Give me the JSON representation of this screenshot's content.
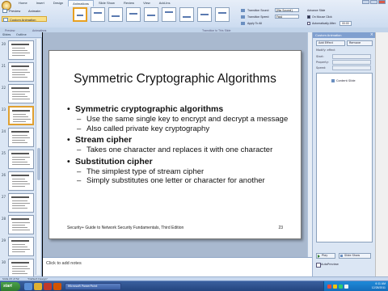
{
  "ribbon": {
    "tabs": [
      "Home",
      "Insert",
      "Design",
      "Animations",
      "Slide Show",
      "Review",
      "View",
      "Add-Ins"
    ],
    "active_tab": "Animations",
    "preview_label": "Preview",
    "animate_label": "Animate:",
    "animate_value": "No Animation",
    "custom_animation_label": "Custom Animation",
    "groups": [
      "Preview",
      "Animations",
      "Transition to This Slide"
    ],
    "transition_sound_label": "Transition Sound:",
    "transition_sound_value": "[No Sound]",
    "transition_speed_label": "Transition Speed:",
    "transition_speed_value": "Fast",
    "apply_all_label": "Apply To All",
    "advance_slide_label": "Advance Slide",
    "on_mouse_click_label": "On Mouse Click",
    "automatically_after_label": "Automatically After:",
    "automatically_after_value": "00:00"
  },
  "slide_pane": {
    "tabs": [
      "Slides",
      "Outline"
    ],
    "slide_numbers": [
      "20",
      "21",
      "22",
      "23",
      "24",
      "25",
      "26",
      "27",
      "28",
      "29",
      "30"
    ],
    "selected_slide": "23"
  },
  "slide": {
    "title": "Symmetric Cryptographic Algorithms",
    "bullets": [
      {
        "text": "Symmetric cryptographic algorithms",
        "subs": [
          "Use the same single key to encrypt and decrypt a message",
          "Also called private key cryptography"
        ]
      },
      {
        "text": "Stream cipher",
        "subs": [
          "Takes one character and replaces it with one character"
        ]
      },
      {
        "text": "Substitution cipher",
        "subs": [
          "The simplest type of stream cipher",
          "Simply substitutes one letter or character for another"
        ]
      }
    ],
    "footer": "Security+ Guide to Network Security Fundamentals, Third Edition",
    "page_number": "23"
  },
  "notes": {
    "placeholder": "Click to add notes"
  },
  "anim_pane": {
    "title": "Custom Animation",
    "close_glyph": "×",
    "add_effect_label": "Add Effect",
    "remove_label": "Remove",
    "modify_label": "Modify: effect",
    "start_label": "Start:",
    "property_label": "Property:",
    "speed_label": "Speed:",
    "list_item": "Content Slide",
    "play_label": "Play",
    "slide_show_label": "Slide Show",
    "autopreview_label": "AutoPreview"
  },
  "status": {
    "slide_info": "Slide 23 of 52",
    "theme": "\"Default Design\""
  },
  "taskbar": {
    "start_label": "start",
    "app_label": "Microsoft PowerPoint",
    "clock_time": "6:11 AM",
    "clock_date": "12/28/2011"
  },
  "colors": {
    "ribbon": "#d4e2f4",
    "slide_bg": "#ffffff",
    "workspace": "#a9b9cf",
    "taskbar": "#24457f",
    "start": "#2e7a2e"
  }
}
